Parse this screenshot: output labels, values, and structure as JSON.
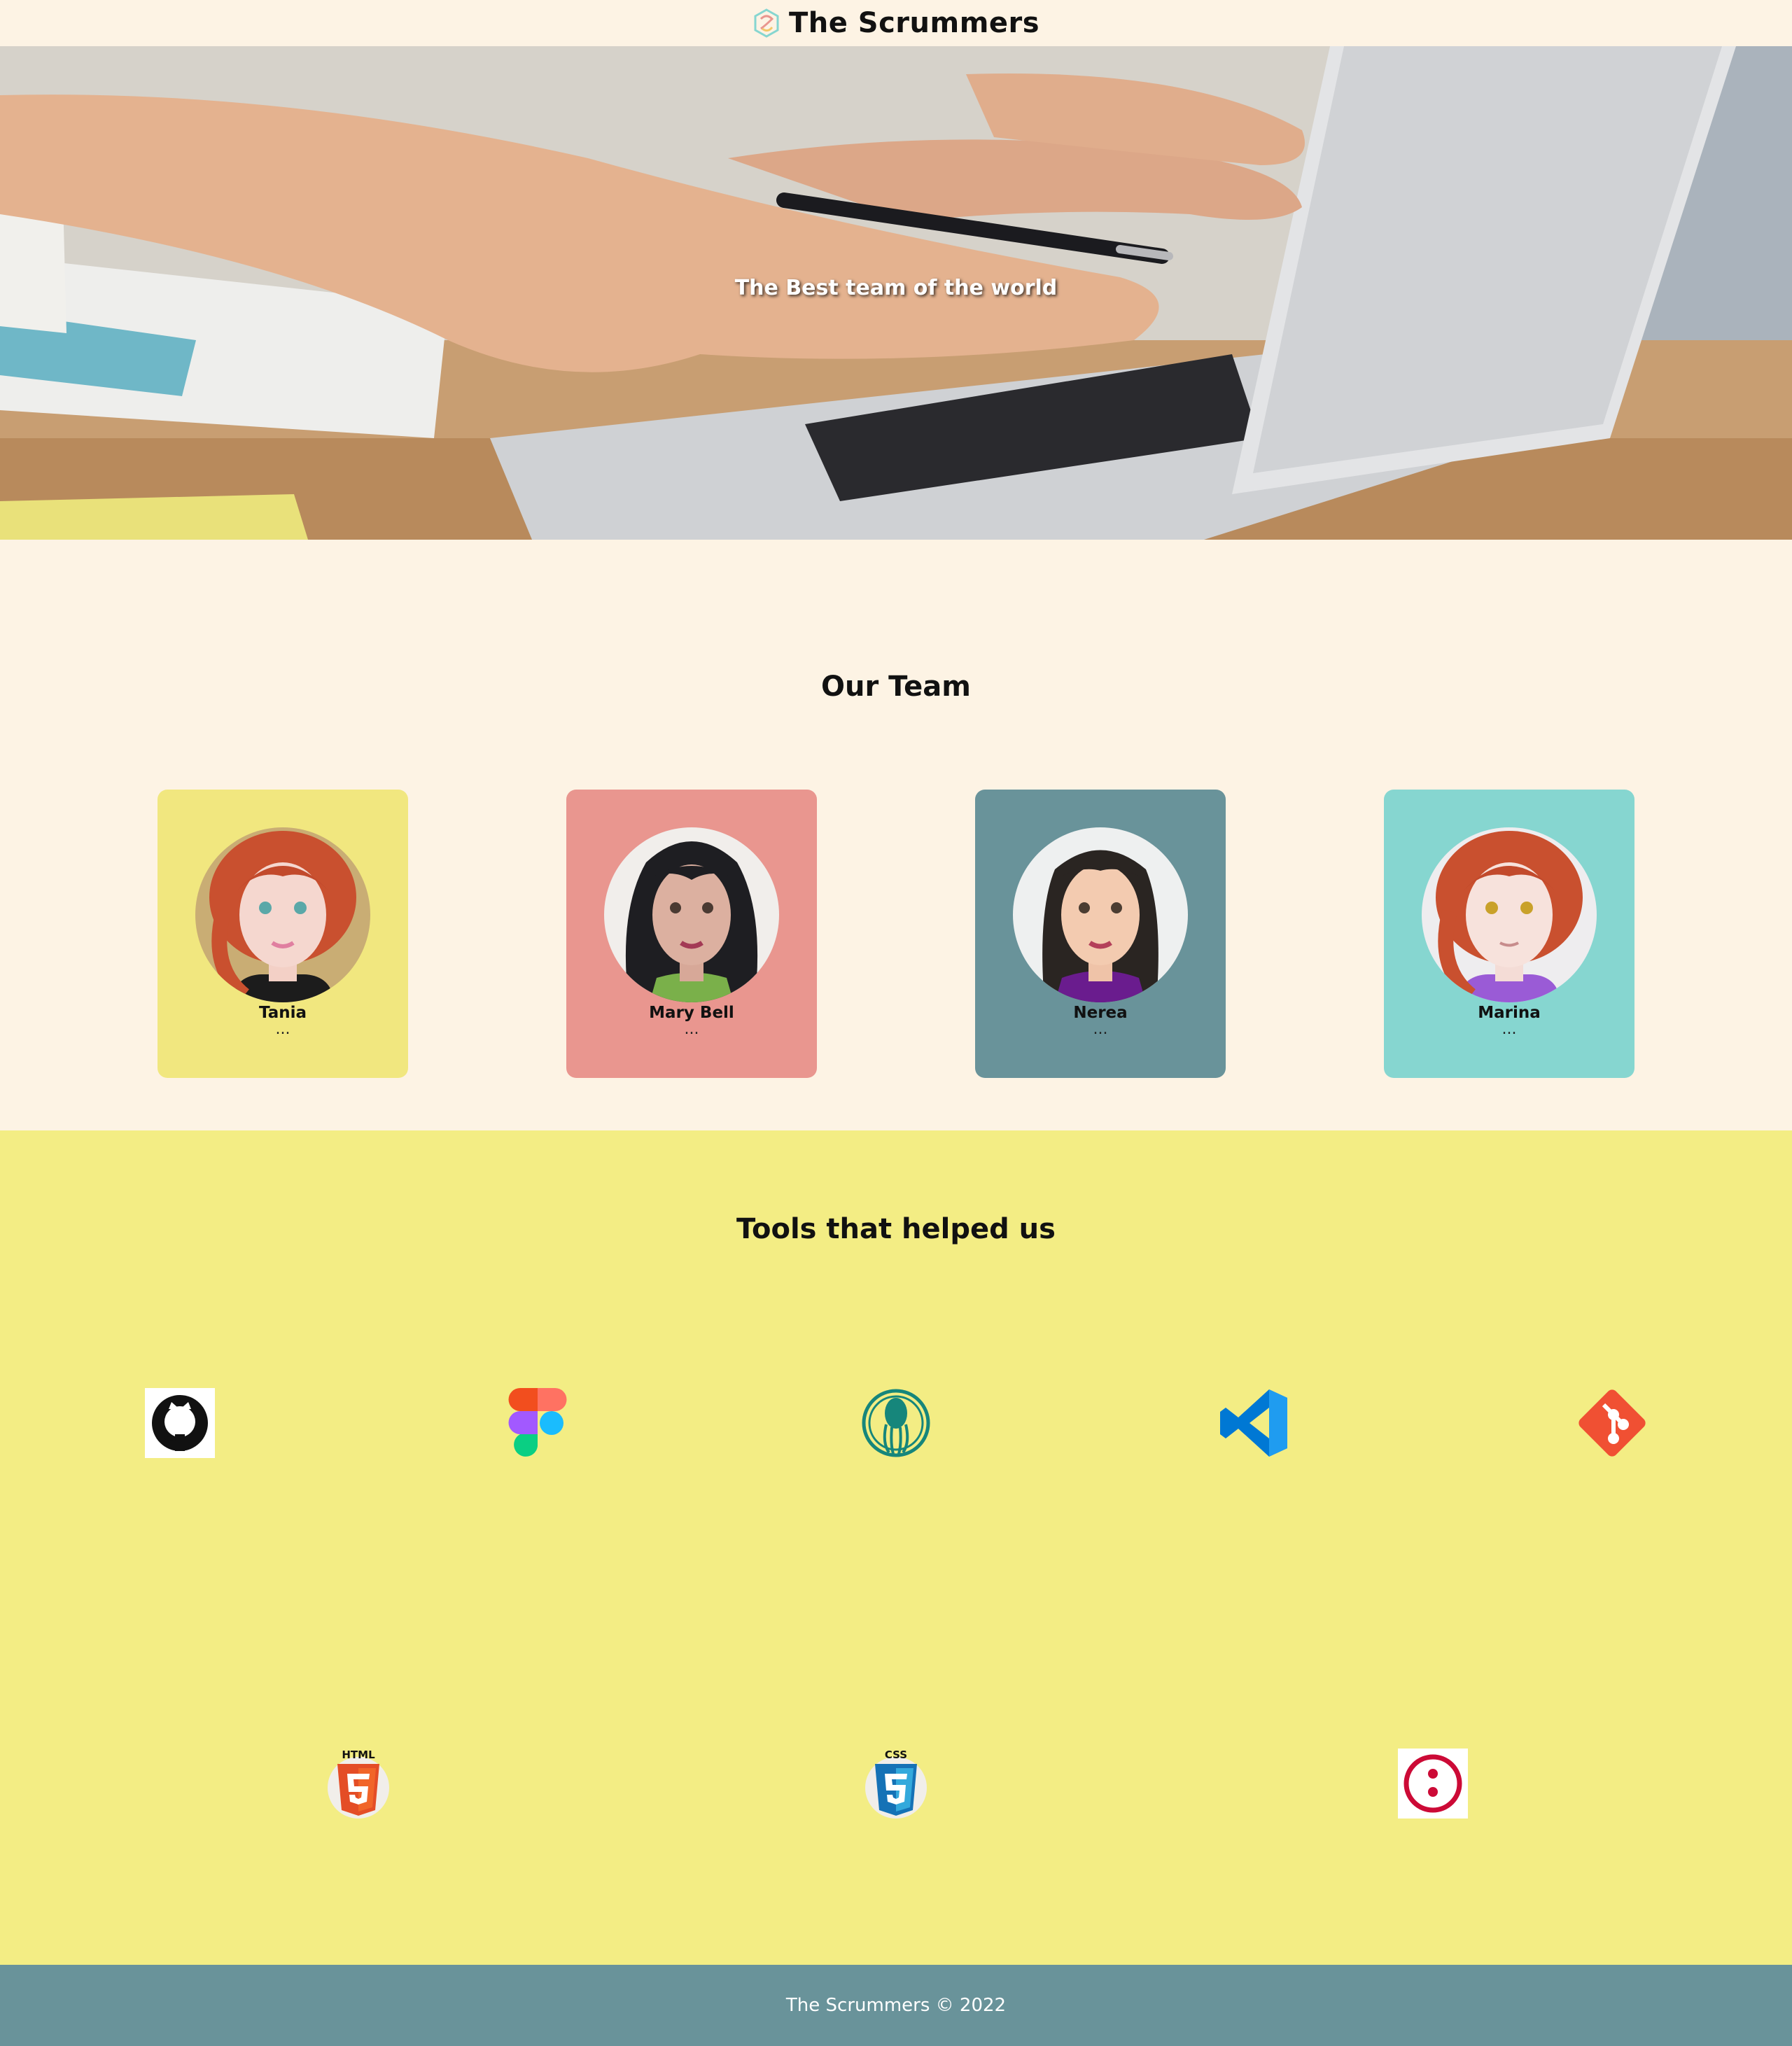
{
  "header": {
    "brand": "The Scrummers",
    "logo_icon": "scrum-logo-icon"
  },
  "hero": {
    "title": "The Best team of the world"
  },
  "team": {
    "title": "Our Team",
    "members": [
      {
        "name": "Tania",
        "role": "...",
        "color": "#f1e77f"
      },
      {
        "name": "Mary Bell",
        "role": "...",
        "color": "#e9968f"
      },
      {
        "name": "Nerea",
        "role": "...",
        "color": "#69939a"
      },
      {
        "name": "Marina",
        "role": "...",
        "color": "#86d6d0"
      }
    ]
  },
  "tools": {
    "title": "Tools that helped us",
    "icons": [
      "github-icon",
      "figma-icon",
      "gitkraken-icon",
      "vscode-icon",
      "git-icon",
      "html5-icon",
      "css3-icon",
      "discord-alt-icon"
    ],
    "labels": {
      "html5": "HTML",
      "css3": "CSS"
    }
  },
  "footer": {
    "text": "The Scrummers © 2022"
  },
  "colors": {
    "background": "#fdf3e4",
    "tools_bg": "#f3ed84",
    "footer_bg": "#69939a"
  }
}
